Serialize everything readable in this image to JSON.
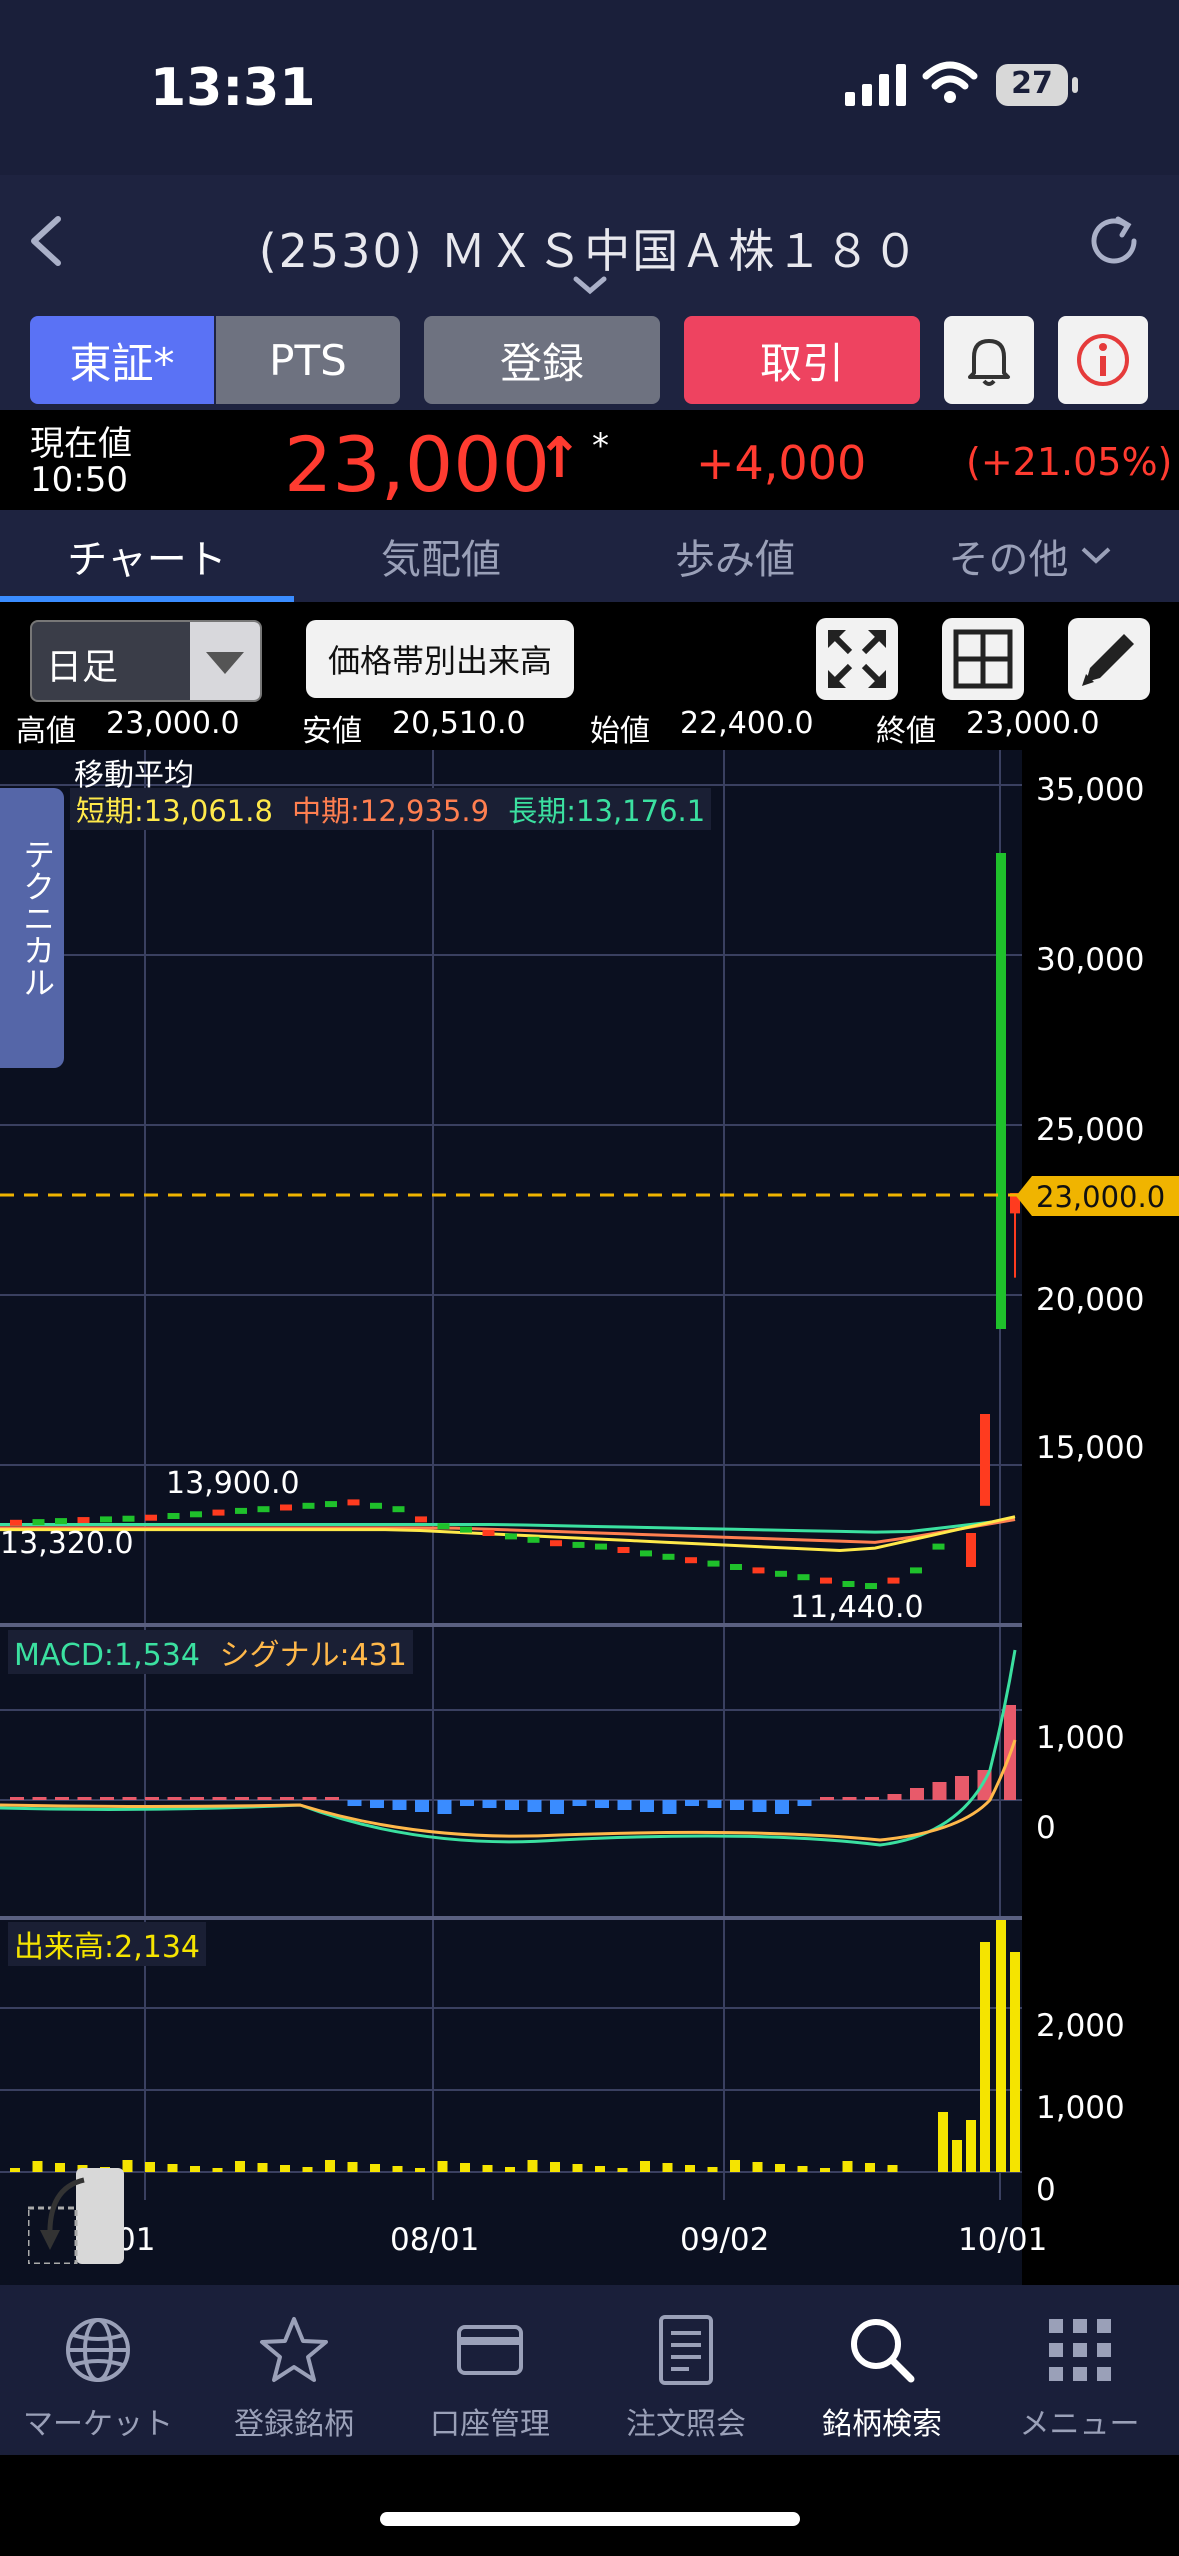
{
  "status_bar": {
    "time": "13:31",
    "battery": "27"
  },
  "nav": {
    "title": "(2530) ＭＸＳ中国Ａ株１８０"
  },
  "buttons": {
    "tse": "東証*",
    "pts": "PTS",
    "register": "登録",
    "trade": "取引"
  },
  "price": {
    "label_line1": "現在値",
    "label_line2": "10:50",
    "current": "23,000",
    "arrow": "↑",
    "asterisk": "*",
    "change": "+4,000",
    "change_pct": "(+21.05%)"
  },
  "tabs": {
    "chart": "チャート",
    "quote": "気配値",
    "ticks": "歩み値",
    "other": "その他"
  },
  "toolbar": {
    "period": "日足",
    "volume_profile": "価格帯別出来高"
  },
  "ohlc": {
    "high_label": "高値",
    "high": "23,000.0",
    "low_label": "安値",
    "low": "20,510.0",
    "open_label": "始値",
    "open": "22,400.0",
    "close_label": "終値",
    "close": "23,000.0"
  },
  "chart": {
    "technical_tab": "テクニカル",
    "ma_title": "移動平均",
    "ma_short": "短期:13,061.8",
    "ma_mid": "中期:12,935.9",
    "ma_long": "長期:13,176.1",
    "price_ticks": [
      "35,000",
      "30,000",
      "25,000",
      "20,000",
      "15,000"
    ],
    "price_marker": "23,000.0",
    "annot_high": "13,900.0",
    "annot_left": "13,320.0",
    "annot_low": "11,440.0",
    "macd_label": "MACD:1,534",
    "signal_label": "シグナル:431",
    "macd_ticks": [
      "1,000",
      "0"
    ],
    "volume_label": "出来高:2,134",
    "volume_ticks": [
      "2,000",
      "1,000",
      "0"
    ],
    "x_ticks": [
      "01",
      "08/01",
      "09/02",
      "10/01"
    ],
    "colors": {
      "up": "#ff3b1f",
      "down": "#1fc12b",
      "ma_short": "#ffe94a",
      "ma_mid": "#ff7f50",
      "ma_long": "#3be0a0",
      "volume": "#f5e400",
      "marker": "#f0b400"
    }
  },
  "chart_data": {
    "type": "candlestick",
    "x_ticks": [
      "01",
      "08/01",
      "09/02",
      "10/01"
    ],
    "price_axis": [
      15000,
      35000
    ],
    "last_close": 23000.0,
    "day_high": 23000.0,
    "day_low": 20510.0,
    "day_open": 22400.0,
    "annotations": [
      13900.0,
      13320.0,
      11440.0
    ],
    "macd": 1534,
    "signal": 431,
    "volume_last": 2134
  },
  "bottom_nav": [
    "マーケット",
    "登録銘柄",
    "口座管理",
    "注文照会",
    "銘柄検索",
    "メニュー"
  ]
}
